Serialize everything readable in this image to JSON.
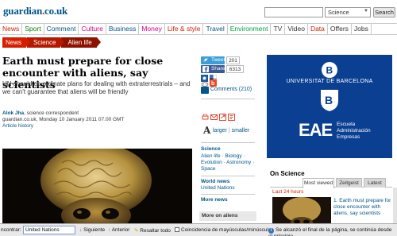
{
  "header": {
    "logo_main": "guardian",
    "logo_dot": ".",
    "logo_tld": "co.uk",
    "search_placeholder": "",
    "search_scope": "Science",
    "search_button": "Search"
  },
  "nav": [
    {
      "label": "News",
      "color": "#d61d00"
    },
    {
      "label": "Sport",
      "color": "#008000"
    },
    {
      "label": "Comment",
      "color": "#005689"
    },
    {
      "label": "Culture",
      "color": "#d1008b"
    },
    {
      "label": "Business",
      "color": "#005689"
    },
    {
      "label": "Money",
      "color": "#d1008b"
    },
    {
      "label": "Life & style",
      "color": "#d61d00"
    },
    {
      "label": "Travel",
      "color": "#005689"
    },
    {
      "label": "Environment",
      "color": "#00a33d"
    },
    {
      "label": "TV",
      "color": "#333333"
    },
    {
      "label": "Video",
      "color": "#333333"
    },
    {
      "label": "Data",
      "color": "#d61d00"
    },
    {
      "label": "Offers",
      "color": "#333333"
    },
    {
      "label": "Jobs",
      "color": "#333333"
    }
  ],
  "breadcrumb": [
    "News",
    "Science",
    "Alien life"
  ],
  "article": {
    "headline": "Earth must prepare for close encounter with aliens, say scientists",
    "standfirst": "UN should co-ordinate plans for dealing with extraterrestrials – and we can't guarantee that aliens will be friendly",
    "author": "Alok Jha",
    "role": ", science correspondent",
    "dateline": "guardian.co.uk, Monday 10 January 2011 07.00 GMT",
    "history_link": "Article history"
  },
  "share": {
    "tweet_label": "Tweet",
    "tweet_count": "201",
    "fb_label": "Share",
    "fb_count": "6313",
    "comments": "Comments (210)",
    "text_size_larger": "larger",
    "text_size_sep": "|",
    "text_size_smaller": "smaller",
    "big_a": "A"
  },
  "sidebar_sections": {
    "science": {
      "title": "Science",
      "links": "Alien life · Biology · Evolution · Astronomy · Space"
    },
    "world": {
      "title": "World news",
      "links": "United Nations"
    },
    "more_news": "More news",
    "more_on_aliens": "More on aliens"
  },
  "ad": {
    "university": "UNIVERSITAT DE BARCELONA",
    "logo": "EAE",
    "logo_sub_1": "Escuela",
    "logo_sub_2": "Administración",
    "logo_sub_3": "Empresas",
    "bg_color": "#0a3f92"
  },
  "on_science": {
    "title": "On Science",
    "tabs": [
      "Most viewed",
      "Zeitgeist",
      "Latest"
    ],
    "active_tab": "Most viewed",
    "period": "Last 24 hours",
    "items": [
      {
        "rank": "1.",
        "title": "Earth must prepare for close encounter with aliens, say scientists"
      }
    ]
  },
  "findbar": {
    "label": "ncontrar:",
    "query": "United Nations",
    "next": "Siguiente",
    "prev": "Anterior",
    "highlight": "Resaltar todo",
    "match_case": "Coincidencia de mayúsculas/minúsculas",
    "status": "Se alcanzó el final de la página, se continúa desde el principio"
  },
  "colors": {
    "brand_blue": "#005689",
    "news_red": "#d61d00"
  }
}
